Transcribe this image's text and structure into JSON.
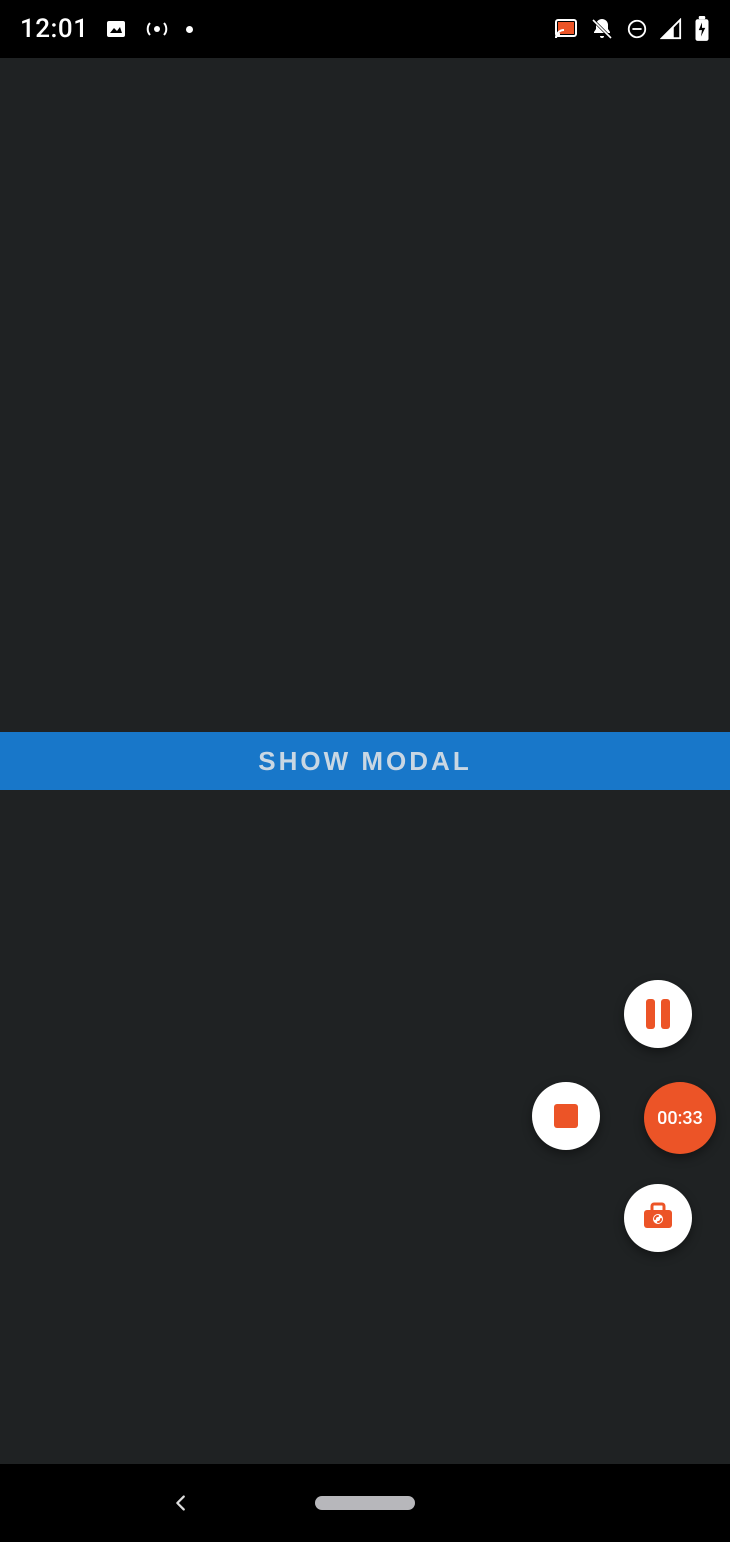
{
  "status_bar": {
    "time": "12:01",
    "left_icons": {
      "image_icon": "image-icon",
      "radio_icon": "radio-icon",
      "dot": "notification-dot"
    },
    "right_icons": {
      "cast": "cast-icon",
      "mute": "bell-off-icon",
      "dnd": "do-not-disturb-icon",
      "signal": "cell-signal-icon",
      "battery": "battery-charging-icon"
    }
  },
  "main": {
    "show_modal_label": "SHOW MODAL"
  },
  "recorder": {
    "pause_icon": "pause",
    "stop_icon": "stop",
    "timer_label": "00:33",
    "tools_icon": "toolbox"
  },
  "nav": {
    "back_icon": "back",
    "home_handle": "home-handle"
  },
  "colors": {
    "accent": "#1877c9",
    "recorder_orange": "#ec5427",
    "app_bg": "#1f2223"
  }
}
